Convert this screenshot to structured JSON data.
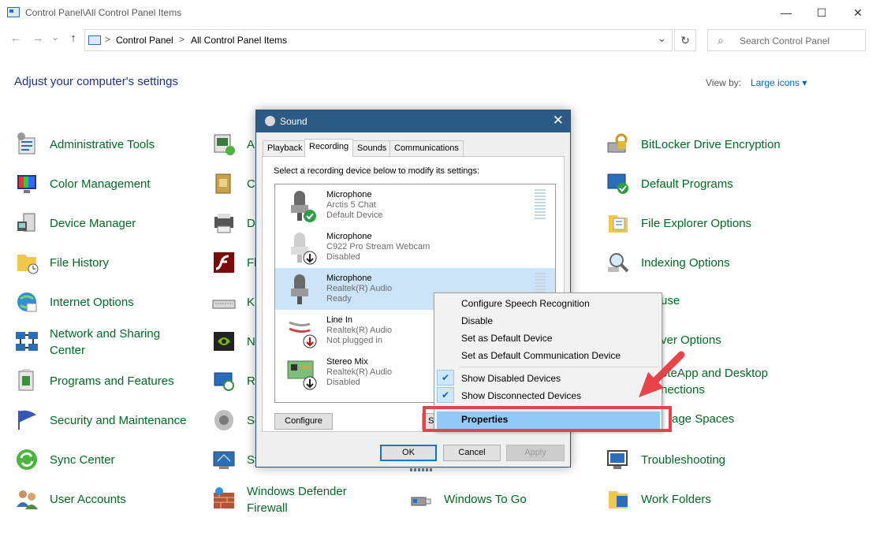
{
  "window": {
    "title": "Control Panel\\All Control Panel Items",
    "minimize_glyph": "—",
    "maximize_glyph": "☐",
    "close_glyph": "✕"
  },
  "toolbar": {
    "back_glyph": "←",
    "forward_glyph": "→",
    "recent_glyph": "⌄",
    "up_glyph": "↑",
    "breadcrumb": [
      "Control Panel",
      "All Control Panel Items"
    ],
    "breadcrumb_sep": ">",
    "dropdown_glyph": "⌄",
    "refresh_glyph": "↻",
    "search_placeholder": "Search Control Panel",
    "search_glyph": "⌕"
  },
  "page": {
    "heading": "Adjust your computer's settings",
    "view_by_label": "View by:",
    "view_by_value": "Large icons ▾"
  },
  "items": {
    "col1": [
      "Administrative Tools",
      "Color Management",
      "Device Manager",
      "File History",
      "Internet Options",
      "Network and Sharing Center",
      "Programs and Features",
      "Security and Maintenance",
      "Sync Center",
      "User Accounts"
    ],
    "col2": [
      "A",
      "C",
      "D",
      "Fl",
      "K",
      "N",
      "R",
      "So",
      "Sy",
      "Windows Defender Firewall"
    ],
    "col3": [
      "Windows To Go"
    ],
    "col4": [
      "BitLocker Drive Encryption",
      "Default Programs",
      "File Explorer Options",
      "Indexing Options",
      "use",
      "ver Options",
      "oteApp and Desktop nections",
      "age Spaces",
      "Troubleshooting",
      "Work Folders"
    ]
  },
  "sound_dialog": {
    "title": "Sound",
    "close_glyph": "✕",
    "tabs": [
      "Playback",
      "Recording",
      "Sounds",
      "Communications"
    ],
    "active_tab": "Recording",
    "instruction": "Select a recording device below to modify its settings:",
    "devices": [
      {
        "name": "Microphone",
        "detail": "Arctis 5 Chat",
        "status": "Default Device"
      },
      {
        "name": "Microphone",
        "detail": "C922 Pro Stream Webcam",
        "status": "Disabled"
      },
      {
        "name": "Microphone",
        "detail": "Realtek(R) Audio",
        "status": "Ready"
      },
      {
        "name": "Line In",
        "detail": "Realtek(R) Audio",
        "status": "Not plugged in"
      },
      {
        "name": "Stereo Mix",
        "detail": "Realtek(R) Audio",
        "status": "Disabled"
      }
    ],
    "configure_label": "Configure",
    "set_default_partial": "Se",
    "ok_label": "OK",
    "cancel_label": "Cancel",
    "apply_label": "Apply"
  },
  "context_menu": {
    "items": [
      "Configure Speech Recognition",
      "Disable",
      "Set as Default Device",
      "Set as Default Communication Device"
    ],
    "check_items": [
      "Show Disabled Devices",
      "Show Disconnected Devices"
    ],
    "check_glyph": "✔",
    "properties_label": "Properties"
  },
  "colors": {
    "link_green": "#006b26",
    "heading_blue": "#1e3287",
    "dialog_title": "#2b5a85",
    "selection": "#cce4f7",
    "menu_highlight": "#91c9f7",
    "annotation_red": "#e8434a"
  }
}
